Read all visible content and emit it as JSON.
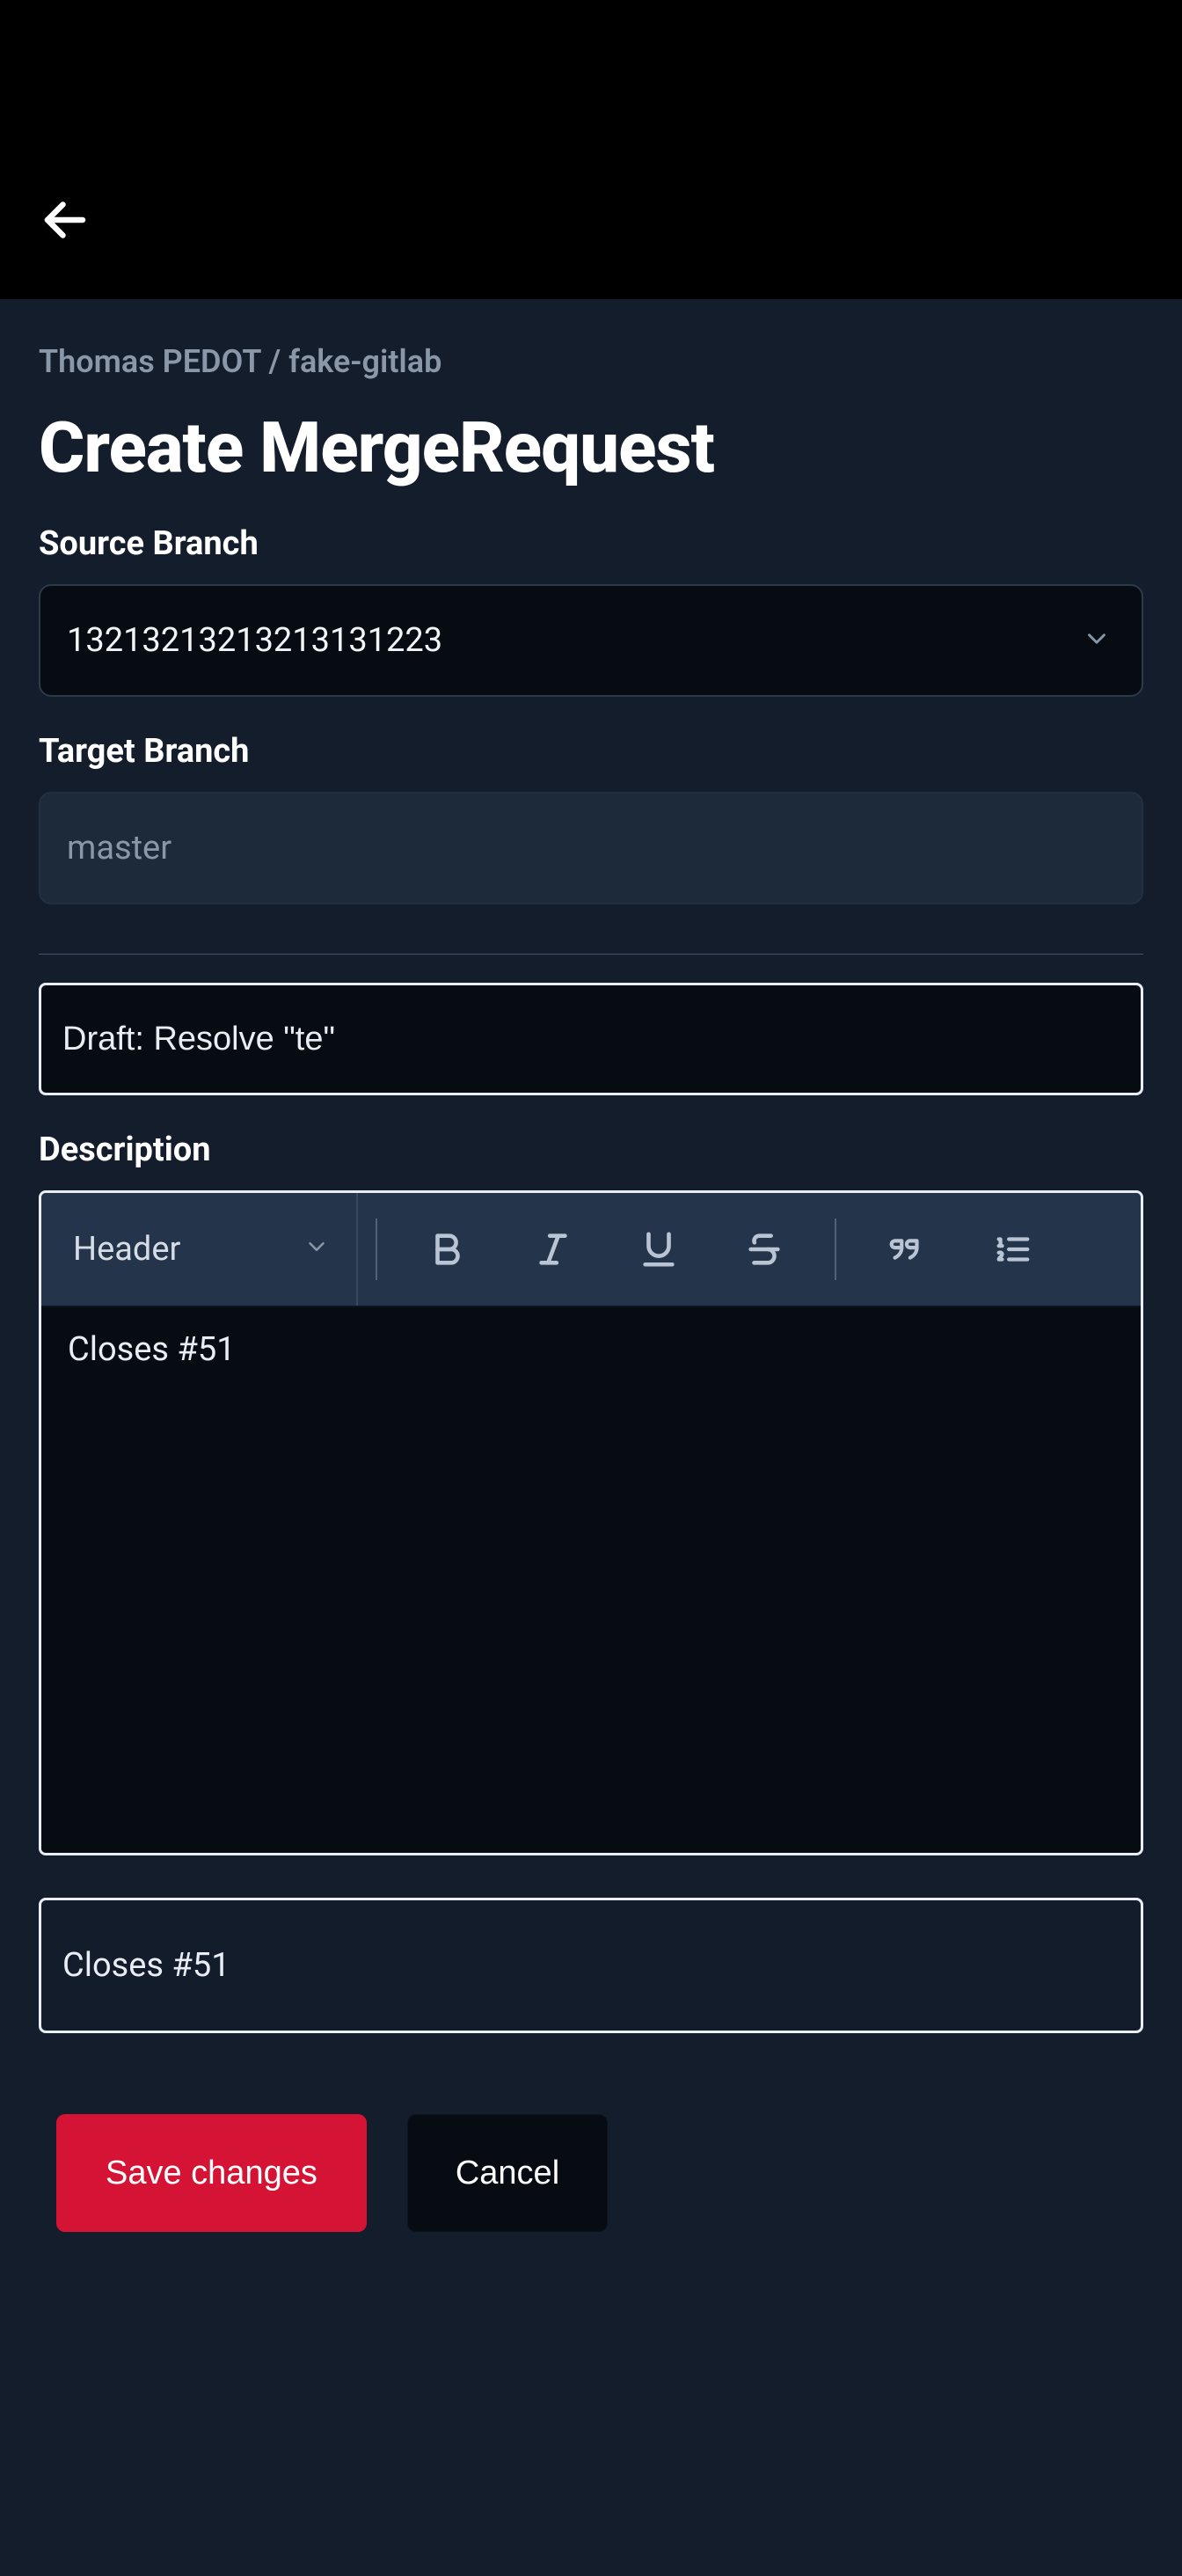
{
  "breadcrumb": "Thomas PEDOT / fake-gitlab",
  "page_title": "Create MergeRequest",
  "source_branch": {
    "label": "Source Branch",
    "value": "13213213213213131223"
  },
  "target_branch": {
    "label": "Target Branch",
    "value": "master"
  },
  "title_input": {
    "value": "Draft: Resolve \"te\""
  },
  "description": {
    "label": "Description",
    "toolbar": {
      "header_select": "Header"
    },
    "body": "Closes #51"
  },
  "closes_text": "Closes #51",
  "buttons": {
    "save": "Save changes",
    "cancel": "Cancel"
  }
}
